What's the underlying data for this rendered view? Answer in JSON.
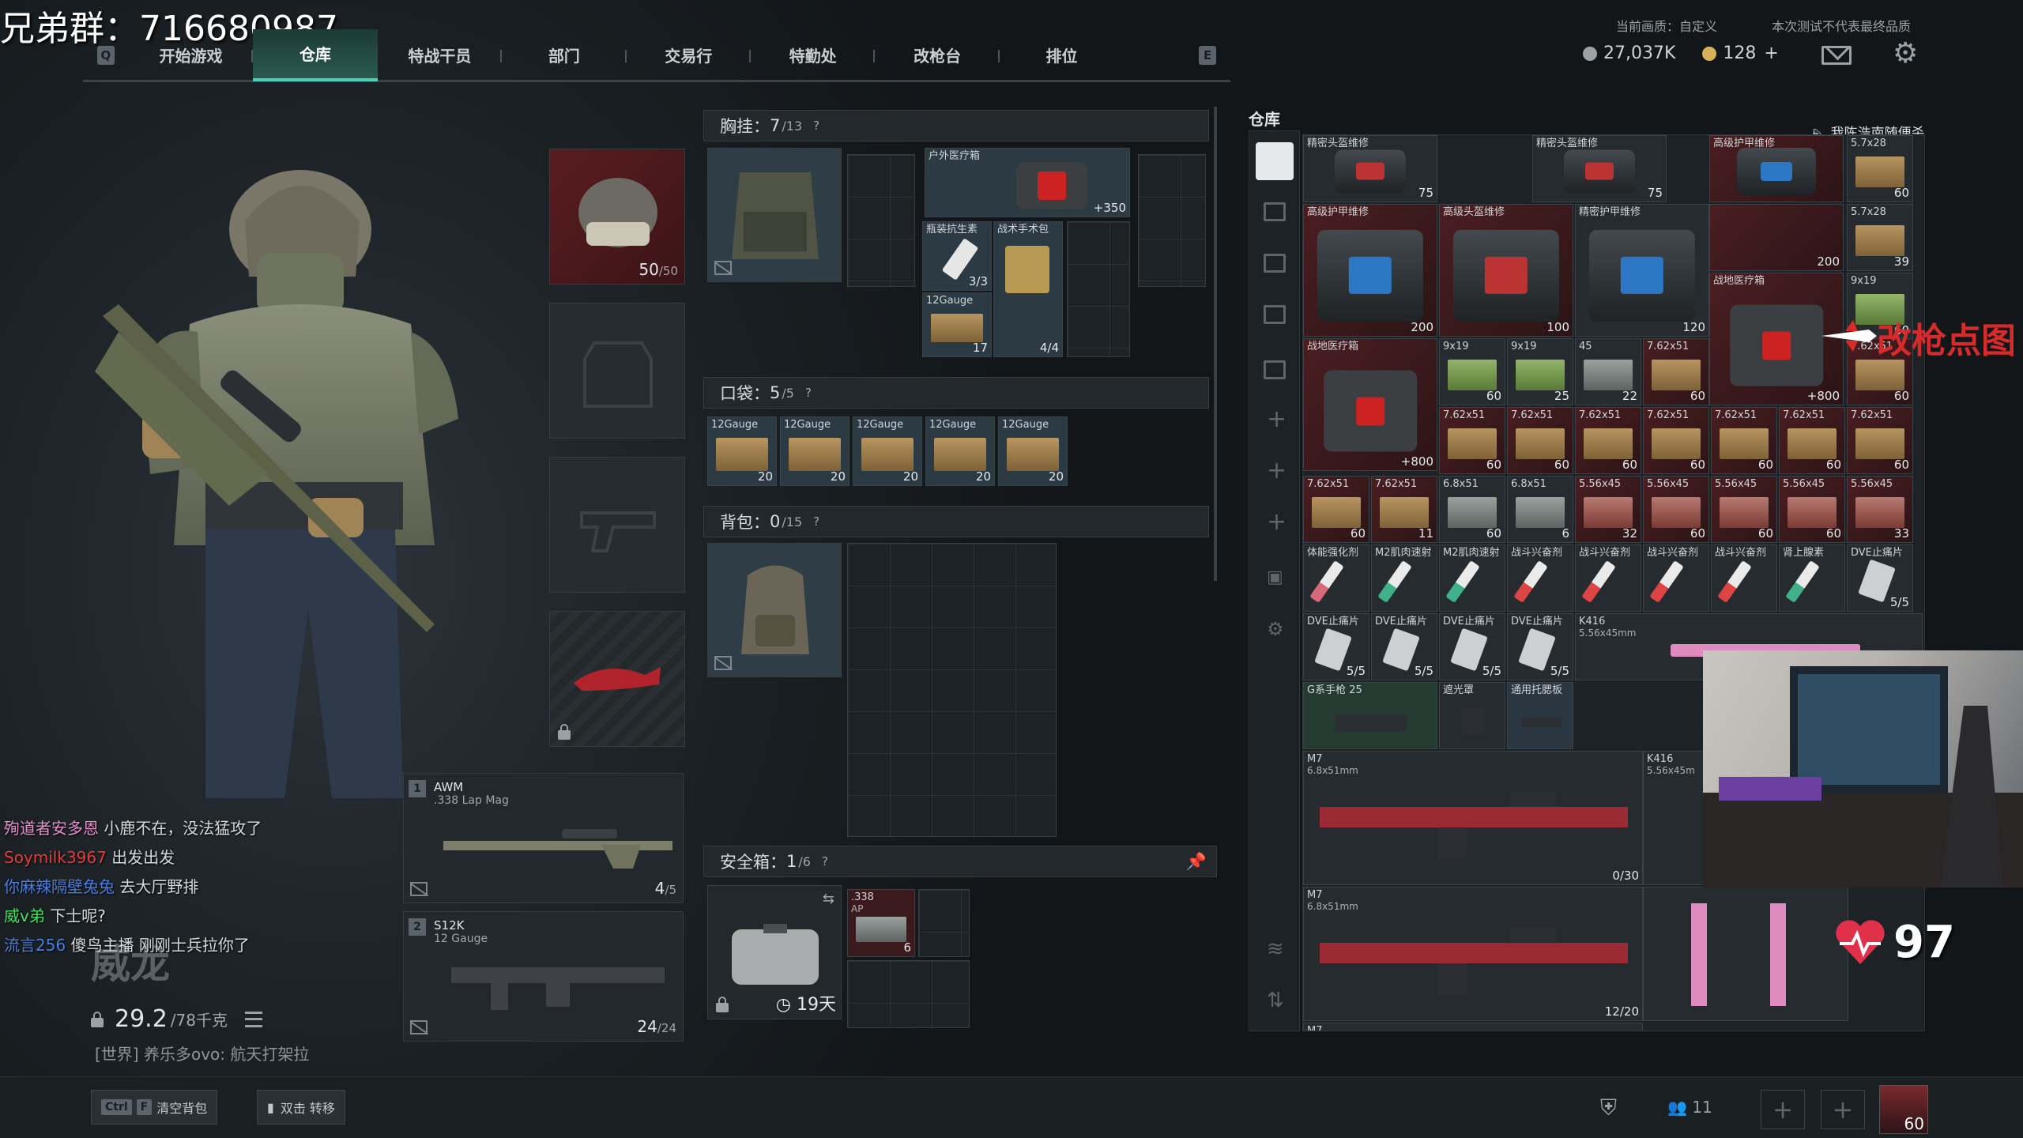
{
  "watermark": "兄弟群：716680987",
  "nav": {
    "key_left": "Q",
    "key_right": "E",
    "tabs": [
      "开始游戏",
      "仓库",
      "特战干员",
      "部门",
      "交易行",
      "特勤处",
      "改枪台",
      "排位"
    ],
    "active": 1
  },
  "top_info": {
    "quality": "当前画质：自定义",
    "notice": "本次测试不代表最终品质",
    "currency_a": "27,037K",
    "currency_b": "128",
    "currency_b_plus": "+"
  },
  "equipment": {
    "helmet_count": "50",
    "helmet_max": "/50"
  },
  "weapons": [
    {
      "num": "1",
      "name": "AWM",
      "sub": ".338 Lap Mag",
      "count": "4",
      "max": "/5"
    },
    {
      "num": "2",
      "name": "S12K",
      "sub": "12 Gauge",
      "count": "24",
      "max": "/24"
    }
  ],
  "chat": [
    {
      "user": "殉道者安多恩",
      "color": "#e88fcd",
      "msg": "小鹿不在，没法猛攻了"
    },
    {
      "user": "Soymilk3967",
      "color": "#e83a3a",
      "msg": "出发出发"
    },
    {
      "user": "你麻辣隔壁兔兔",
      "color": "#4a7de0",
      "msg": "去大厅野排"
    },
    {
      "user": "威v弟",
      "color": "#46e05c",
      "msg": "下士呢?"
    },
    {
      "user": "流言256",
      "color": "#4a7de0",
      "msg": "傻鸟主播 刚刚士兵拉你了"
    }
  ],
  "player": {
    "name": "威龙",
    "weight": "29.2",
    "weight_max": "/78千克",
    "world_chat": "[世界] 养乐多ovo: 航天打架拉"
  },
  "bottom": {
    "key1": "Ctrl",
    "key2": "F",
    "clear_label": "清空背包",
    "transfer_label": "双击 转移",
    "squad_count": "11",
    "level": "60"
  },
  "rig": {
    "label": "胸挂：",
    "count": "7",
    "max": "/13",
    "help": "?",
    "items": [
      {
        "name": "户外医疗箱",
        "qty": "+350"
      },
      {
        "name": "瓶装抗生素",
        "qty": "3/3"
      },
      {
        "name": "战术手术包",
        "qty": "4/4"
      },
      {
        "name": "12Gauge",
        "qty": "17"
      }
    ]
  },
  "pocket": {
    "label": "口袋：",
    "count": "5",
    "max": "/5",
    "help": "?",
    "items": [
      {
        "name": "12Gauge",
        "qty": "20"
      },
      {
        "name": "12Gauge",
        "qty": "20"
      },
      {
        "name": "12Gauge",
        "qty": "20"
      },
      {
        "name": "12Gauge",
        "qty": "20"
      },
      {
        "name": "12Gauge",
        "qty": "20"
      }
    ]
  },
  "backpack": {
    "label": "背包：",
    "count": "0",
    "max": "/15",
    "help": "?"
  },
  "safebox": {
    "label": "安全箱：",
    "count": "1",
    "max": "/6",
    "help": "?",
    "timer": "19天",
    "item_name": ".338",
    "item_sub": "AP",
    "item_qty": "6"
  },
  "stash": {
    "title": "仓库",
    "announce": "我陈浩南随便杀",
    "row1": [
      {
        "name": "精密头盔维修",
        "qty": "75"
      },
      {
        "name": "精密头盔维修",
        "qty": "75"
      },
      {
        "name": "高级护甲维修",
        "qty": ""
      },
      {
        "name": "5.7x28",
        "qty": "60"
      }
    ],
    "row2": [
      {
        "name": "高级护甲维修",
        "qty": "200"
      },
      {
        "name": "高级头盔维修",
        "qty": "100"
      },
      {
        "name": "精密护甲维修",
        "qty": "120"
      },
      {
        "name": "",
        "qty": "200"
      },
      {
        "name": "5.7x28",
        "qty": "39"
      }
    ],
    "row3": [
      {
        "name": "战地医疗箱",
        "qty": "+800"
      },
      {
        "name": "战地医疗箱",
        "qty": "+800"
      },
      {
        "name": "9x19",
        "qty": "60"
      }
    ],
    "ammo_a": [
      {
        "name": "9x19",
        "qty": "60"
      },
      {
        "name": "9x19",
        "qty": "25"
      },
      {
        "name": "45",
        "qty": "22"
      },
      {
        "name": "7.62x51",
        "qty": "60"
      },
      {
        "name": "7.62x51",
        "qty": "60"
      }
    ],
    "ammo_b": [
      {
        "name": "7.62x51",
        "qty": "60"
      },
      {
        "name": "7.62x51",
        "qty": "60"
      },
      {
        "name": "7.62x51",
        "qty": "60"
      },
      {
        "name": "7.62x51",
        "qty": "60"
      },
      {
        "name": "7.62x51",
        "qty": "60"
      },
      {
        "name": "7.62x51",
        "qty": "60"
      },
      {
        "name": "7.62x51",
        "qty": "60"
      }
    ],
    "ammo_c": [
      {
        "name": "7.62x51",
        "qty": "60"
      },
      {
        "name": "7.62x51",
        "qty": "11"
      },
      {
        "name": "6.8x51",
        "qty": "60"
      },
      {
        "name": "6.8x51",
        "qty": "6"
      },
      {
        "name": "5.56x45",
        "qty": "32"
      },
      {
        "name": "5.56x45",
        "qty": "60"
      },
      {
        "name": "5.56x45",
        "qty": "60"
      },
      {
        "name": "5.56x45",
        "qty": "60"
      },
      {
        "name": "5.56x45",
        "qty": "33"
      }
    ],
    "meds": [
      {
        "name": "体能强化剂",
        "qty": ""
      },
      {
        "name": "M2肌肉速射",
        "qty": ""
      },
      {
        "name": "M2肌肉速射",
        "qty": ""
      },
      {
        "name": "战斗兴奋剂",
        "qty": ""
      },
      {
        "name": "战斗兴奋剂",
        "qty": ""
      },
      {
        "name": "战斗兴奋剂",
        "qty": ""
      },
      {
        "name": "战斗兴奋剂",
        "qty": ""
      },
      {
        "name": "肾上腺素",
        "qty": ""
      },
      {
        "name": "DVE止痛片",
        "qty": "5/5"
      }
    ],
    "cards": [
      {
        "name": "DVE止痛片",
        "qty": "5/5"
      },
      {
        "name": "DVE止痛片",
        "qty": "5/5"
      },
      {
        "name": "DVE止痛片",
        "qty": "5/5"
      },
      {
        "name": "DVE止痛片",
        "qty": "5/5"
      }
    ],
    "k416_top": {
      "name": "K416",
      "sub": "5.56x45mm"
    },
    "misc": [
      {
        "name": "G系手枪 25"
      },
      {
        "name": "遮光罩"
      },
      {
        "name": "通用托腮板"
      }
    ],
    "m7_1": {
      "name": "M7",
      "sub": "6.8x51mm",
      "qty": "0/30"
    },
    "k416_2": {
      "name": "K416",
      "sub": "5.56x45m"
    },
    "m7_2": {
      "name": "M7",
      "sub": "6.8x51mm",
      "qty": "12/20"
    },
    "m7_3": {
      "name": "M7"
    }
  },
  "overlay": {
    "text": "改枪点图",
    "heart_rate": "97"
  }
}
